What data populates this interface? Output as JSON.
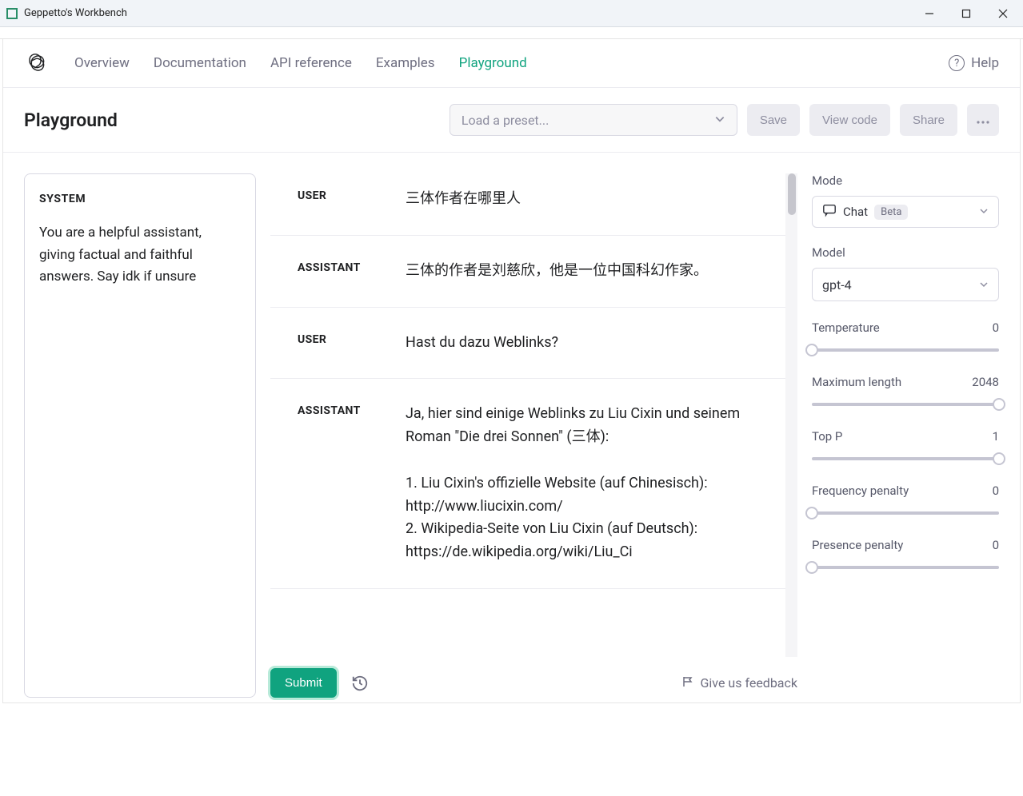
{
  "window": {
    "title": "Geppetto's Workbench"
  },
  "nav": {
    "links": [
      "Overview",
      "Documentation",
      "API reference",
      "Examples",
      "Playground"
    ],
    "active_index": 4,
    "help_label": "Help"
  },
  "header": {
    "title": "Playground",
    "preset_placeholder": "Load a preset...",
    "save": "Save",
    "view_code": "View code",
    "share": "Share"
  },
  "system": {
    "label": "SYSTEM",
    "content": "You are a helpful assistant, giving factual and faithful answers. Say idk if unsure"
  },
  "messages": [
    {
      "role": "USER",
      "content": "三体作者在哪里人"
    },
    {
      "role": "ASSISTANT",
      "content": "三体的作者是刘慈欣，他是一位中国科幻作家。"
    },
    {
      "role": "USER",
      "content": "Hast du dazu Weblinks?"
    },
    {
      "role": "ASSISTANT",
      "content": "Ja, hier sind einige Weblinks zu Liu Cixin und seinem Roman \"Die drei Sonnen\" (三体):\n\n1. Liu Cixin's offizielle Website (auf Chinesisch): http://www.liucixin.com/\n2. Wikipedia-Seite von Liu Cixin (auf Deutsch): https://de.wikipedia.org/wiki/Liu_Ci"
    }
  ],
  "footer": {
    "submit": "Submit",
    "feedback": "Give us feedback"
  },
  "side": {
    "mode": {
      "label": "Mode",
      "value": "Chat",
      "badge": "Beta"
    },
    "model": {
      "label": "Model",
      "value": "gpt-4"
    },
    "params": {
      "temperature": {
        "label": "Temperature",
        "value": "0",
        "pos": 0
      },
      "max_length": {
        "label": "Maximum length",
        "value": "2048",
        "pos": 100
      },
      "top_p": {
        "label": "Top P",
        "value": "1",
        "pos": 100
      },
      "freq_penalty": {
        "label": "Frequency penalty",
        "value": "0",
        "pos": 0
      },
      "pres_penalty": {
        "label": "Presence penalty",
        "value": "0",
        "pos": 0
      }
    }
  }
}
